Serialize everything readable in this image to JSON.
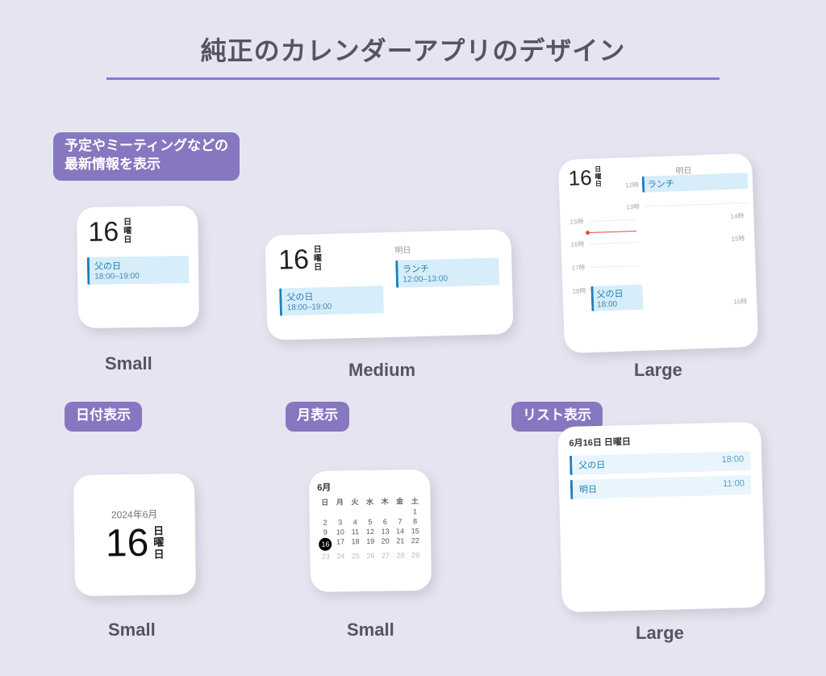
{
  "title": "純正のカレンダーアプリのデザイン",
  "badges": {
    "upnext": "予定やミーティングなどの\n最新情報を表示",
    "date": "日付表示",
    "month": "月表示",
    "list": "リスト表示"
  },
  "size": {
    "small": "Small",
    "medium": "Medium",
    "large": "Large"
  },
  "daynum": "16",
  "dayname0": "日",
  "dayname1": "曜",
  "dayname2": "日",
  "daynamefull": "日曜日",
  "monthyear": "2024年6月",
  "ev_fathersday": {
    "title": "父の日",
    "time": "18:00–19:00",
    "time_start": "18:00"
  },
  "ev_lunch": {
    "title": "ランチ",
    "time": "12:00–13:00"
  },
  "ev_tomorrow": {
    "title": "明日",
    "time": "11:00"
  },
  "tomorrow": "明日",
  "list_header": "6月16日 日曜日",
  "hours": {
    "h12": "12時",
    "h13": "13時",
    "h14": "14時",
    "h15": "15時",
    "h16": "16時",
    "h17": "17時",
    "h18": "18時"
  },
  "month_label": "6月",
  "dow": [
    "日",
    "月",
    "火",
    "水",
    "木",
    "金",
    "土"
  ],
  "month_grid": [
    [
      " ",
      " ",
      " ",
      " ",
      " ",
      " ",
      "1"
    ],
    [
      "2",
      "3",
      "4",
      "5",
      "6",
      "7",
      "8"
    ],
    [
      "9",
      "10",
      "11",
      "12",
      "13",
      "14",
      "15"
    ],
    [
      "16",
      "17",
      "18",
      "19",
      "20",
      "21",
      "22"
    ],
    [
      "23",
      "24",
      "25",
      "26",
      "27",
      "28",
      "29"
    ]
  ]
}
